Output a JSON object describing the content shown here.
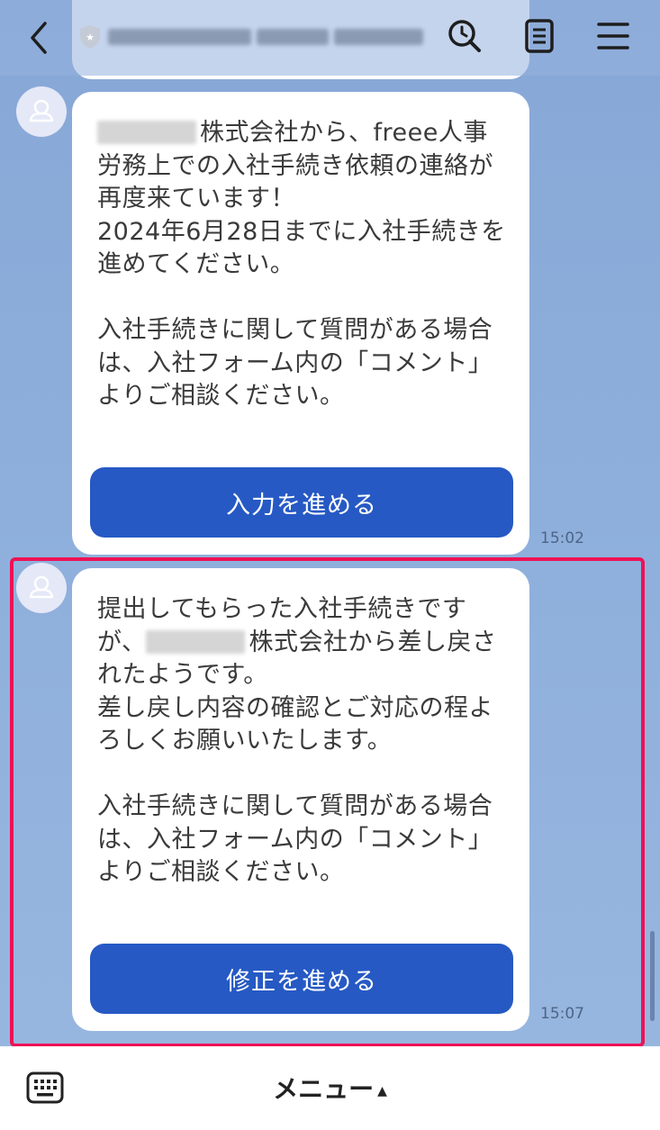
{
  "header": {
    "title_redacted": true
  },
  "messages": [
    {
      "company_redacted": true,
      "text_after_redaction": "株式会社から、freee人事労務上での入社手続き依頼の連絡が再度来ています！\n2024年6月28日までに入社手続きを進めてください。\n\n入社手続きに関して質問がある場合は、入社フォーム内の「コメント」よりご相談ください。",
      "button_label": "入力を進める",
      "time": "15:02"
    },
    {
      "text_line1": "提出してもらった入社手続きですが、",
      "text_after_redaction": "株式会社から差し戻されたようです。\n差し戻し内容の確認とご対応の程よろしくお願いいたします。\n\n入社手続きに関して質問がある場合は、入社フォーム内の「コメント」よりご相談ください。",
      "button_label": "修正を進める",
      "time": "15:07"
    }
  ],
  "previous_time": "15:02",
  "bottom_bar": {
    "menu_label": "メニュー",
    "menu_arrow": "▲"
  },
  "colors": {
    "chat_background": "#8eacd8",
    "button": "#2659c4",
    "highlight": "#ee1156"
  },
  "icons": [
    "back-icon",
    "shield-icon",
    "search-clock-icon",
    "note-icon",
    "menu-icon",
    "avatar-icon",
    "keyboard-icon"
  ]
}
